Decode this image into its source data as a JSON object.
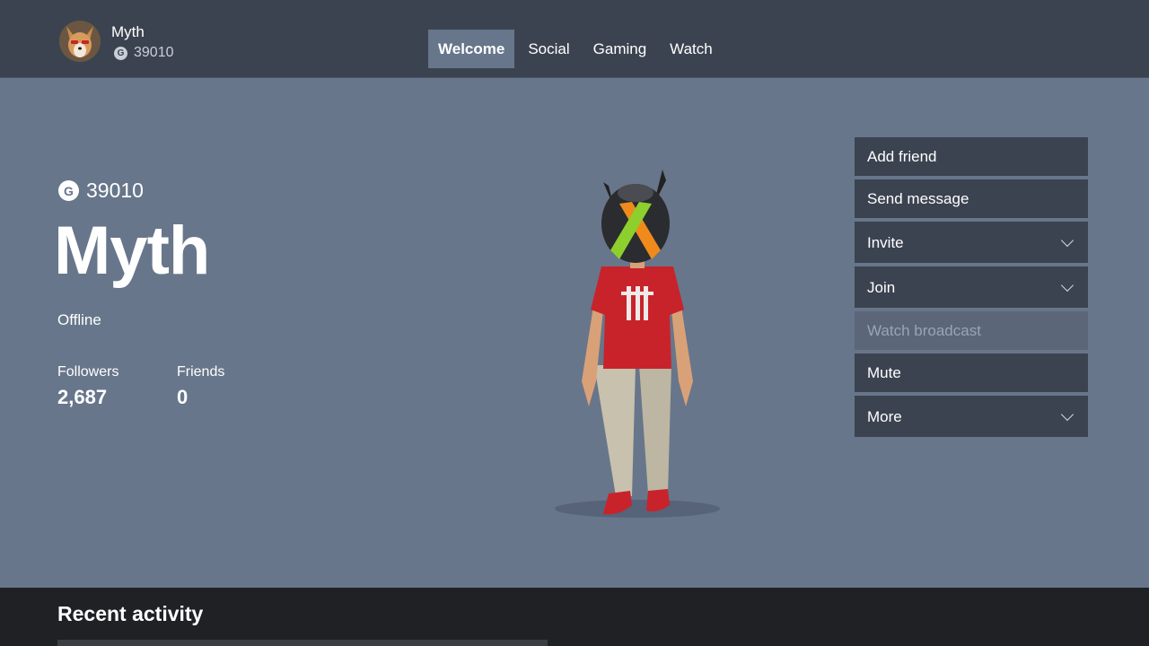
{
  "header": {
    "gamertag": "Myth",
    "gamerscore": "39010",
    "gamerscore_badge": "G",
    "tabs": [
      {
        "label": "Welcome",
        "active": true
      },
      {
        "label": "Social",
        "active": false
      },
      {
        "label": "Gaming",
        "active": false
      },
      {
        "label": "Watch",
        "active": false
      }
    ]
  },
  "profile": {
    "gamerscore_badge": "G",
    "gamerscore": "39010",
    "gamertag": "Myth",
    "status": "Offline",
    "followers_label": "Followers",
    "followers_value": "2,687",
    "friends_label": "Friends",
    "friends_value": "0"
  },
  "actions": [
    {
      "label": "Add friend",
      "has_chevron": false,
      "disabled": false
    },
    {
      "label": "Send message",
      "has_chevron": false,
      "disabled": false
    },
    {
      "label": "Invite",
      "has_chevron": true,
      "disabled": false
    },
    {
      "label": "Join",
      "has_chevron": true,
      "disabled": false
    },
    {
      "label": "Watch broadcast",
      "has_chevron": false,
      "disabled": true
    },
    {
      "label": "Mute",
      "has_chevron": false,
      "disabled": false
    },
    {
      "label": "More",
      "has_chevron": true,
      "disabled": false
    }
  ],
  "recent": {
    "title": "Recent activity"
  },
  "colors": {
    "background": "#67768b",
    "topbar": "#3b4350",
    "menu_item": "#3b4350",
    "recent_bg": "#1f2124"
  }
}
